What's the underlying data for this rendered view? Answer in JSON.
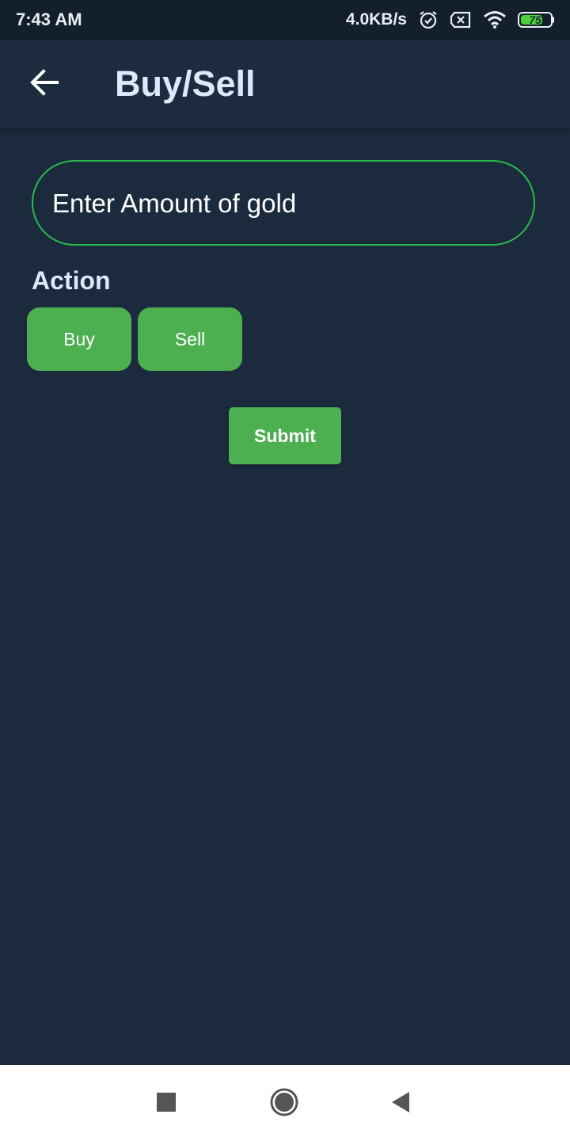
{
  "status_bar": {
    "time": "7:43 AM",
    "net_speed": "4.0KB/s",
    "battery_level": "75",
    "battery_fraction": 0.75,
    "icons": [
      "alarm-icon",
      "sim-blocked-icon",
      "wifi-icon",
      "battery-icon"
    ]
  },
  "app_bar": {
    "title": "Buy/Sell",
    "back_icon": "arrow-left-icon"
  },
  "form": {
    "amount_placeholder": "Enter Amount of gold",
    "amount_value": "",
    "action_label": "Action",
    "buy_label": "Buy",
    "sell_label": "Sell",
    "submit_label": "Submit"
  },
  "nav_bar": {
    "icons": [
      "recents-square-icon",
      "home-circle-icon",
      "back-triangle-icon"
    ]
  },
  "colors": {
    "background": "#1b2b3d",
    "app_bar": "#1c2c3e",
    "status_bar": "#141f2c",
    "accent_green": "#4caf50",
    "field_border": "#2db84d",
    "title_text": "#dde8fb"
  }
}
